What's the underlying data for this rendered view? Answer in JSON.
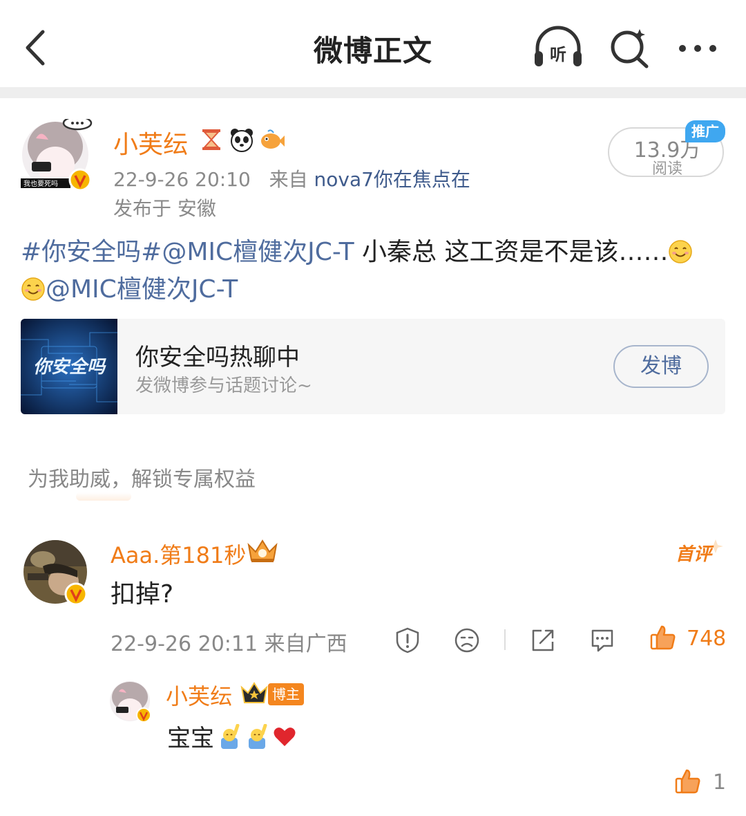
{
  "header": {
    "title": "微博正文",
    "listen_label": "听"
  },
  "post": {
    "username": "小芙纭",
    "timestamp": "22-9-26 20:10",
    "source_prefix": "来自",
    "source": "nova7你在焦点在",
    "location": "发布于 安徽",
    "avatar_caption": "我也要死吗",
    "reads_count": "13.9万",
    "reads_label": "阅读",
    "promo_tag": "推广",
    "body": {
      "hashtag": "#你安全吗#",
      "mention_1": "@MIC檀健次JC-T",
      "text": " 小秦总 这工资是不是该……",
      "mention_2": "@MIC檀健次JC-T"
    },
    "topic_card": {
      "thumb_text": "你安全吗",
      "title": "你安全吗热聊中",
      "subtitle": "发微博参与话题讨论~",
      "button": "发博"
    },
    "promo_text": "为我助威，解锁专属权益"
  },
  "comments": [
    {
      "username": "Aaa.第181秒",
      "badge_label": "首评",
      "text": "扣掉?",
      "meta": "22-9-26 20:11  来自广西",
      "likes": "748",
      "replies": [
        {
          "username": "小芙纭",
          "tag": "博主",
          "text": "宝宝",
          "likes": "1"
        }
      ]
    }
  ],
  "colors": {
    "accent": "#f07c18",
    "link": "#4f6c9e",
    "promo_blue": "#3fa7f0",
    "muted": "#888888"
  }
}
